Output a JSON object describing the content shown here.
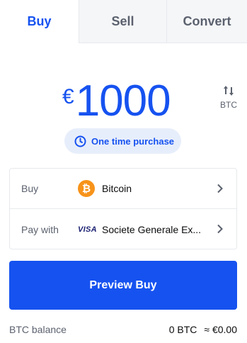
{
  "tabs": [
    {
      "label": "Buy",
      "active": true
    },
    {
      "label": "Sell",
      "active": false
    },
    {
      "label": "Convert",
      "active": false
    }
  ],
  "amount": {
    "currency_symbol": "€",
    "value": "1000"
  },
  "switch": {
    "icon": "swap-vertical-icon",
    "unit": "BTC"
  },
  "purchase_type": {
    "icon": "clock-icon",
    "label": "One time purchase"
  },
  "order": {
    "buy": {
      "label": "Buy",
      "asset_icon": "bitcoin-icon",
      "asset_symbol": "₿",
      "asset_name": "Bitcoin"
    },
    "pay_with": {
      "label": "Pay with",
      "method_icon": "visa-icon",
      "method_brand": "VISA",
      "method_name": "Societe Generale Ex..."
    }
  },
  "preview_button": {
    "label": "Preview Buy"
  },
  "balance": {
    "label": "BTC balance",
    "amount": "0 BTC",
    "fiat": "≈ €0.00"
  },
  "colors": {
    "accent": "#1652f0",
    "bitcoin": "#f7931a",
    "pill_bg": "#e7eefb",
    "muted_text": "#5b616e"
  }
}
